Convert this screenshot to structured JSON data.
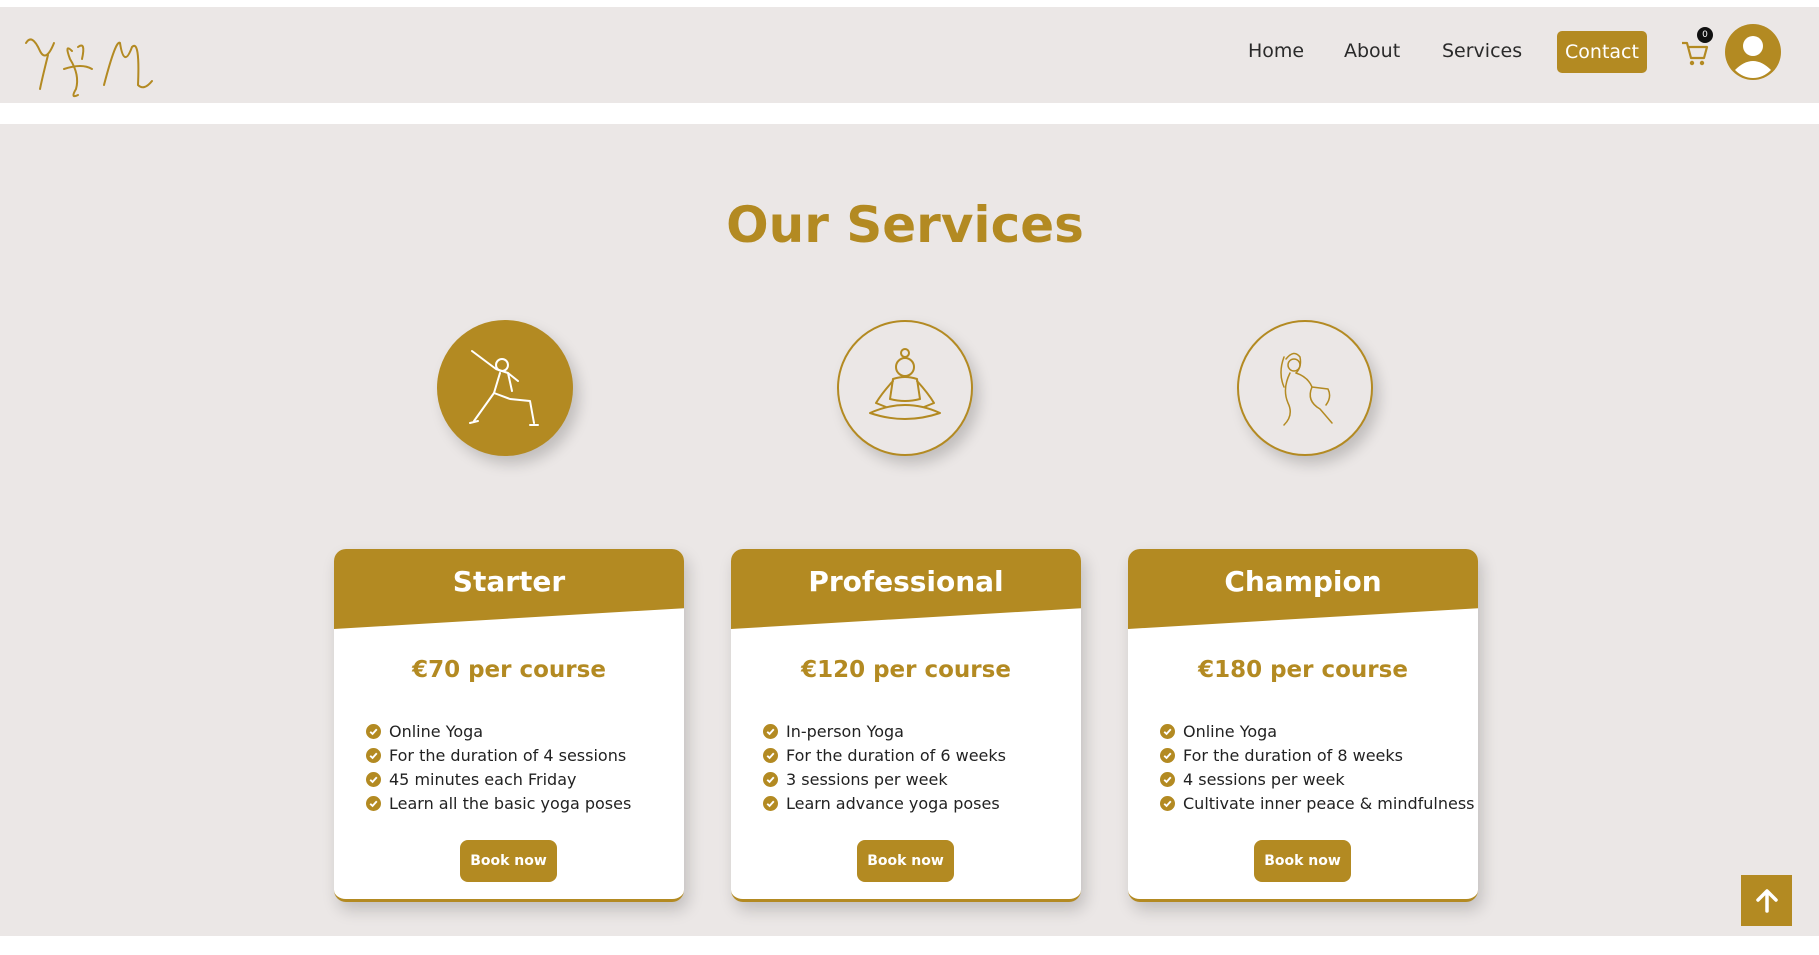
{
  "brand": {
    "logo_text": "Y&M",
    "accent": "#b38a22",
    "background": "#ebe7e6"
  },
  "nav": {
    "links": [
      {
        "label": "Home"
      },
      {
        "label": "About"
      },
      {
        "label": "Services"
      }
    ],
    "contact_label": "Contact",
    "cart_count": "0",
    "cart_icon": "cart-icon",
    "avatar_icon": "user-avatar-icon"
  },
  "section": {
    "title": "Our Services"
  },
  "icons": [
    {
      "name": "yoga-side-stretch-icon",
      "style": "filled"
    },
    {
      "name": "yoga-meditation-icon",
      "style": "outline"
    },
    {
      "name": "yoga-advanced-pose-icon",
      "style": "outline"
    }
  ],
  "plans": [
    {
      "title": "Starter",
      "price": "€70 per course",
      "features": [
        "Online Yoga",
        "For the duration of 4 sessions",
        "45 minutes each Friday",
        "Learn all the basic yoga poses"
      ],
      "button": "Book now"
    },
    {
      "title": "Professional",
      "price": "€120 per course",
      "features": [
        "In-person Yoga",
        "For the duration of 6 weeks",
        "3 sessions per week",
        "Learn advance yoga poses"
      ],
      "button": "Book now"
    },
    {
      "title": "Champion",
      "price": "€180 per course",
      "features": [
        "Online Yoga",
        "For the duration of 8 weeks",
        "4 sessions per week",
        "Cultivate inner peace & mindfulness"
      ],
      "button": "Book now"
    }
  ],
  "scroll_top_icon": "arrow-up-icon"
}
